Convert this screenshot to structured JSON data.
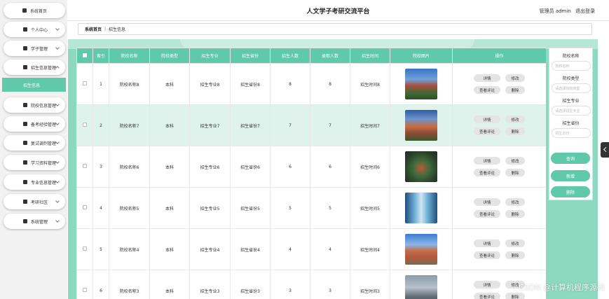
{
  "header": {
    "title": "人文学子考研交流平台",
    "role": "管理员 admin",
    "logout": "退出登录"
  },
  "breadcrumb": {
    "home": "系统首页",
    "current": "招生信息"
  },
  "sidebar": {
    "items": [
      {
        "label": "系统首页",
        "icon": "home-icon"
      },
      {
        "label": "个人中心",
        "icon": "user-icon"
      },
      {
        "label": "学子管理",
        "icon": "user-icon"
      },
      {
        "label": "招生信息管理",
        "icon": "grid-icon"
      },
      {
        "label": "院校信息管理",
        "icon": "folder-icon"
      },
      {
        "label": "备考经验管理",
        "icon": "grid-icon"
      },
      {
        "label": "复试调剂管理",
        "icon": "user-icon"
      },
      {
        "label": "学习资料管理",
        "icon": "list-icon"
      },
      {
        "label": "专业信息管理",
        "icon": "folder-icon"
      },
      {
        "label": "考研社区",
        "icon": "user-icon"
      },
      {
        "label": "系统管理",
        "icon": "chart-icon"
      }
    ],
    "active_sub": "招生信息"
  },
  "table": {
    "headers": [
      "",
      "索引",
      "院校名称",
      "院校类型",
      "招生专业",
      "招生省份",
      "招生人数",
      "录取人数",
      "招生时间",
      "院校图片",
      "操作"
    ],
    "rows": [
      {
        "index": "1",
        "school": "院校名称8",
        "type": "本科",
        "major": "招生专业8",
        "province": "招生省份8",
        "enroll": "8",
        "admitted": "8",
        "time": "招生时间8"
      },
      {
        "index": "2",
        "school": "院校名称7",
        "type": "本科",
        "major": "招生专业7",
        "province": "招生省份7",
        "enroll": "7",
        "admitted": "7",
        "time": "招生时间7"
      },
      {
        "index": "3",
        "school": "院校名称6",
        "type": "本科",
        "major": "招生专业6",
        "province": "招生省份6",
        "enroll": "6",
        "admitted": "6",
        "time": "招生时间6"
      },
      {
        "index": "4",
        "school": "院校名称5",
        "type": "本科",
        "major": "招生专业5",
        "province": "招生省份5",
        "enroll": "5",
        "admitted": "5",
        "time": "招生时间5"
      },
      {
        "index": "5",
        "school": "院校名称4",
        "type": "本科",
        "major": "招生专业4",
        "province": "招生省份4",
        "enroll": "4",
        "admitted": "4",
        "time": "招生时间4"
      },
      {
        "index": "6",
        "school": "院校名称3",
        "type": "本科",
        "major": "招生专业3",
        "province": "招生省份3",
        "enroll": "3",
        "admitted": "3",
        "time": "招生时间3"
      }
    ],
    "actions": {
      "detail": "详情",
      "edit": "修改",
      "comments": "查看评论",
      "delete": "删除"
    }
  },
  "search": {
    "name_label": "院校名称",
    "name_placeholder": "院校名称",
    "type_label": "院校类型",
    "type_placeholder": "请选择院校类型",
    "major_label": "招生专业",
    "major_placeholder": "请选择招生专业",
    "province_label": "招生省份",
    "province_placeholder": "招生省份",
    "query": "查询",
    "add": "新增",
    "delete": "删除"
  },
  "watermark": "CSDN @计算机程序源码",
  "colors": {
    "accent": "#5fc9a9",
    "band": "#8cd9bf",
    "highlight_row": "#dff3ec"
  }
}
